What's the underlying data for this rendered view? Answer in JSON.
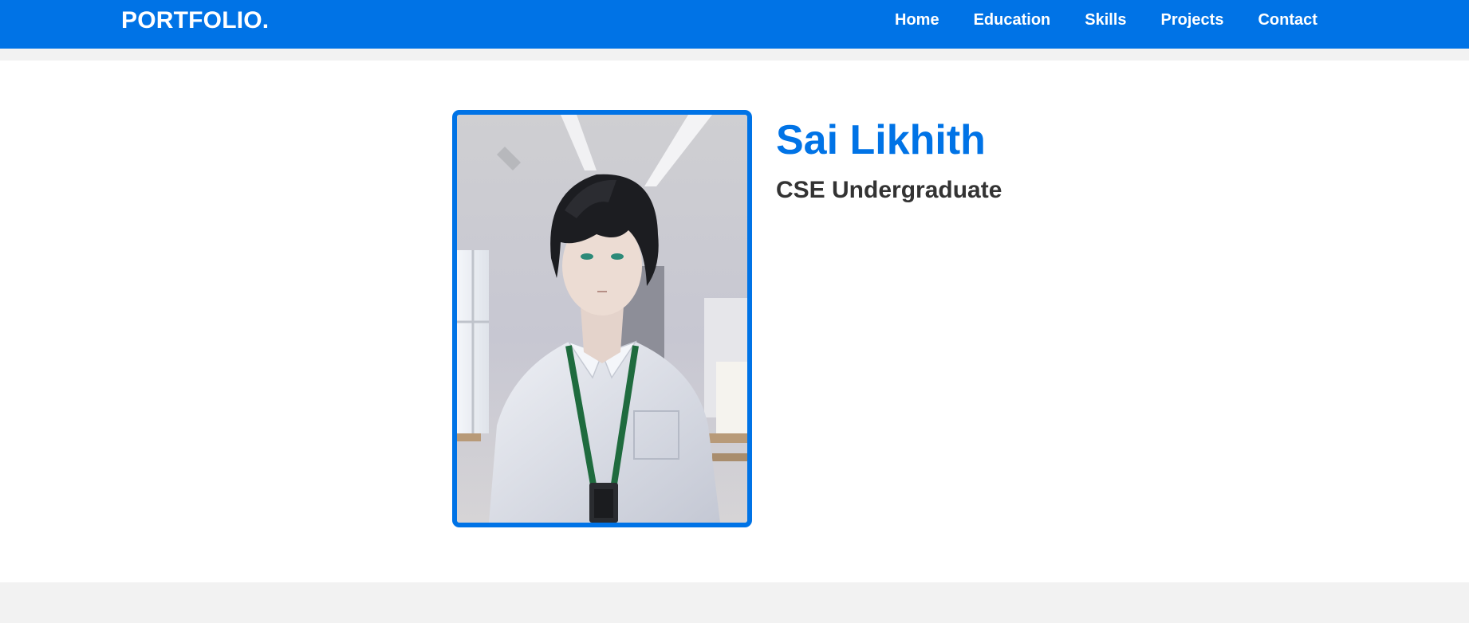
{
  "header": {
    "brand": "PORTFOLIO.",
    "nav": [
      {
        "label": "Home"
      },
      {
        "label": "Education"
      },
      {
        "label": "Skills"
      },
      {
        "label": "Projects"
      },
      {
        "label": "Contact"
      }
    ]
  },
  "hero": {
    "name": "Sai Likhith",
    "role": "CSE Undergraduate"
  },
  "colors": {
    "accent": "#0073e6",
    "page_background": "#f2f2f2",
    "section_background": "#ffffff",
    "role_text": "#333333"
  }
}
